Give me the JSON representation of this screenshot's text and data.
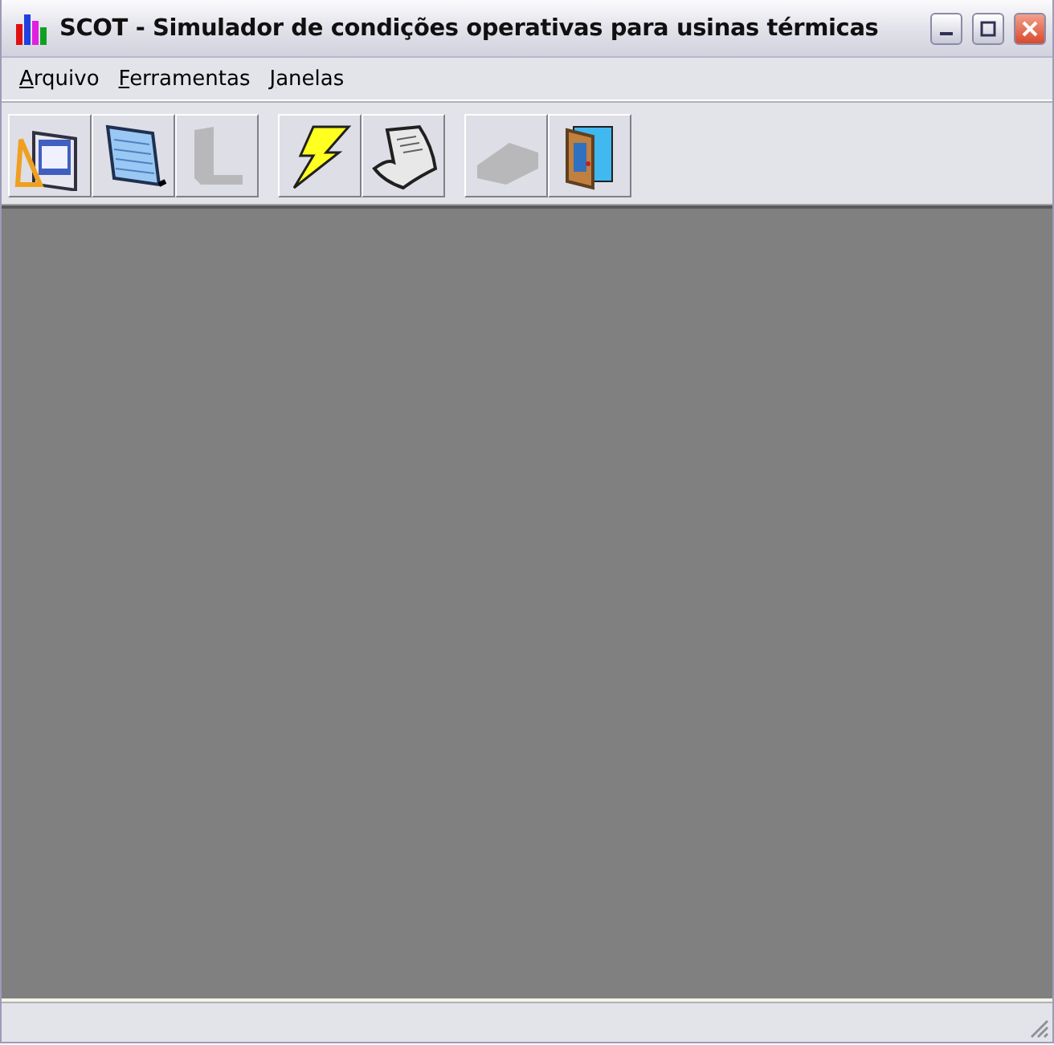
{
  "window": {
    "title": "SCOT - Simulador de condições operativas para usinas térmicas"
  },
  "menu": [
    {
      "label": "Arquivo"
    },
    {
      "label": "Ferramentas"
    },
    {
      "label": "Janelas"
    }
  ],
  "toolbar": [
    {
      "disabled": false
    },
    {
      "disabled": false
    },
    {
      "disabled": true
    },
    {
      "disabled": false
    },
    {
      "disabled": false
    },
    {
      "disabled": true
    },
    {
      "disabled": false
    }
  ]
}
